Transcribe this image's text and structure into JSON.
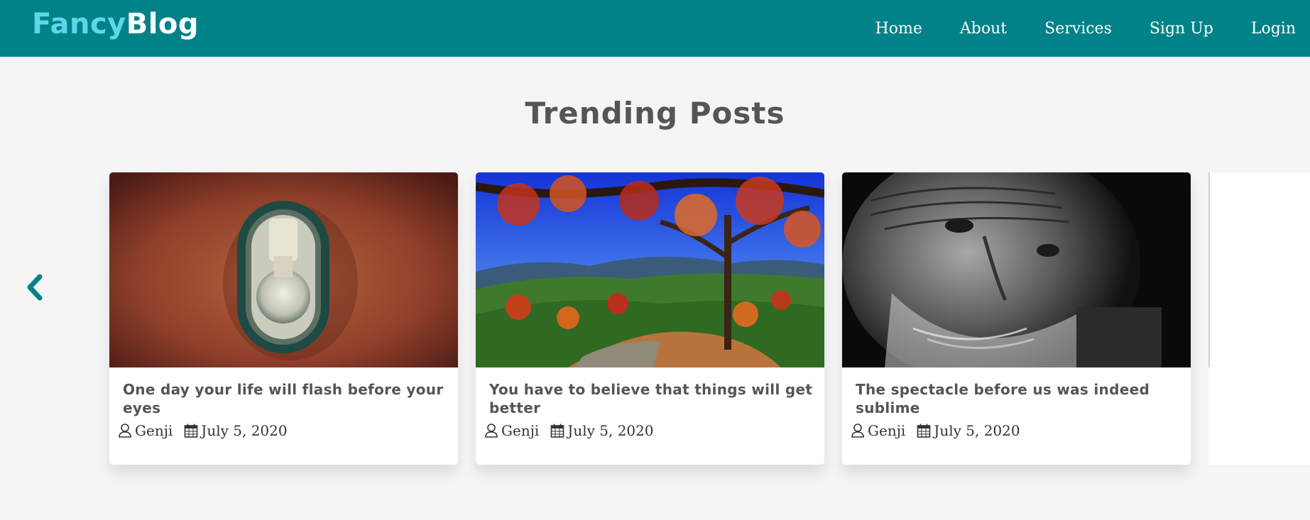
{
  "header": {
    "logo_part1": "Fancy",
    "logo_part2": "Blog",
    "nav": [
      "Home",
      "About",
      "Services",
      "Sign Up",
      "Login"
    ]
  },
  "main": {
    "title": "Trending Posts",
    "posts": [
      {
        "title": "One day your life will flash before your eyes",
        "author": "Genji",
        "date": "July 5, 2020",
        "image": "light-bulb-on-wall-photo"
      },
      {
        "title": "You have to believe that things will get better",
        "author": "Genji",
        "date": "July 5, 2020",
        "image": "autumn-tree-landscape-photo"
      },
      {
        "title": "The spectacle before us was indeed sublime",
        "author": "Genji",
        "date": "July 5, 2020",
        "image": "old-man-portrait-photo"
      }
    ]
  },
  "colors": {
    "navbar": "#008288",
    "logo_accent": "#5fd6e8",
    "arrow": "#008288",
    "background": "#f5f5f5"
  },
  "icons": {
    "prev": "chevron-left-icon",
    "next": "chevron-right-icon",
    "author": "user-icon",
    "date": "calendar-icon"
  }
}
